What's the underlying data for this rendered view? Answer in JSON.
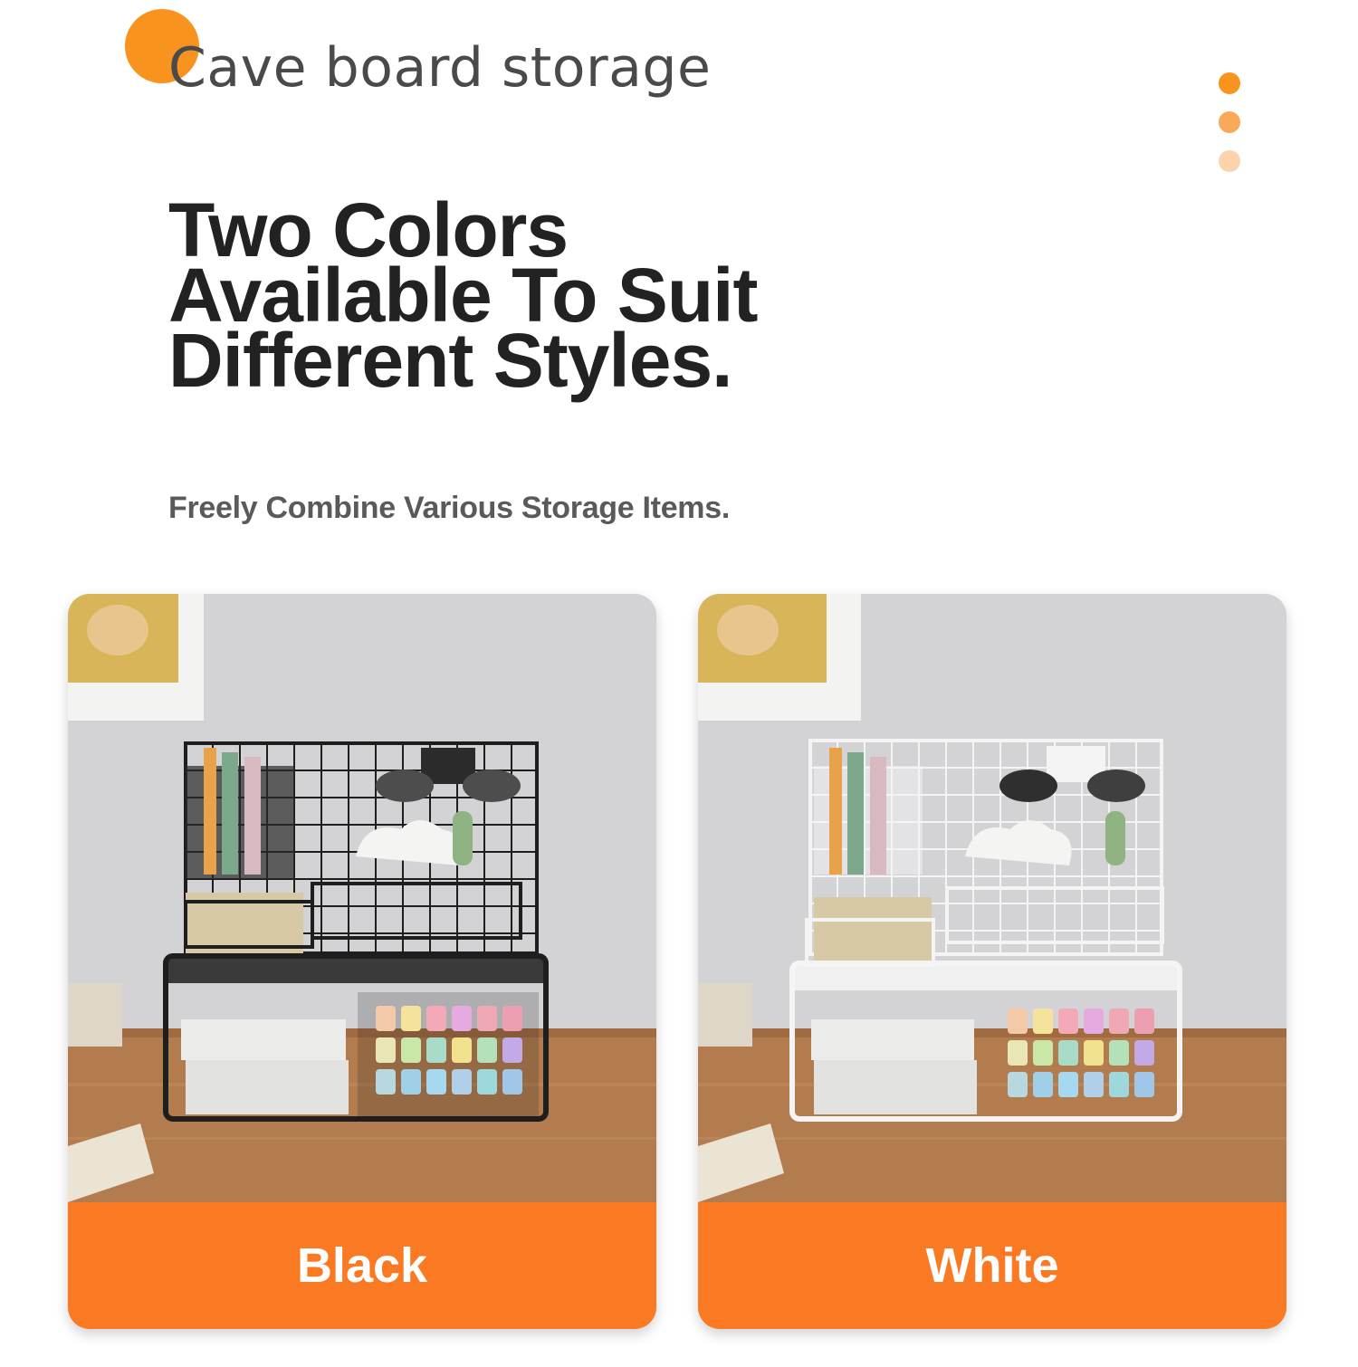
{
  "brand": {
    "title": "Cave board storage",
    "accent": "#f7931e"
  },
  "pager": {
    "dots": [
      "#f7931e",
      "#f9a95a",
      "#fcd3ab"
    ]
  },
  "headline": {
    "lines": [
      "Two Colors",
      "Available To Suit",
      "Different Styles."
    ]
  },
  "subheadline": "Freely Combine Various Storage Items.",
  "products": [
    {
      "label": "Black",
      "frame_color": "#1e1e1e"
    },
    {
      "label": "White",
      "frame_color": "#f2f2f2"
    }
  ],
  "colors": {
    "label_bar": "#f97a23",
    "headline": "#222222",
    "subheadline": "#5a5a5a"
  }
}
